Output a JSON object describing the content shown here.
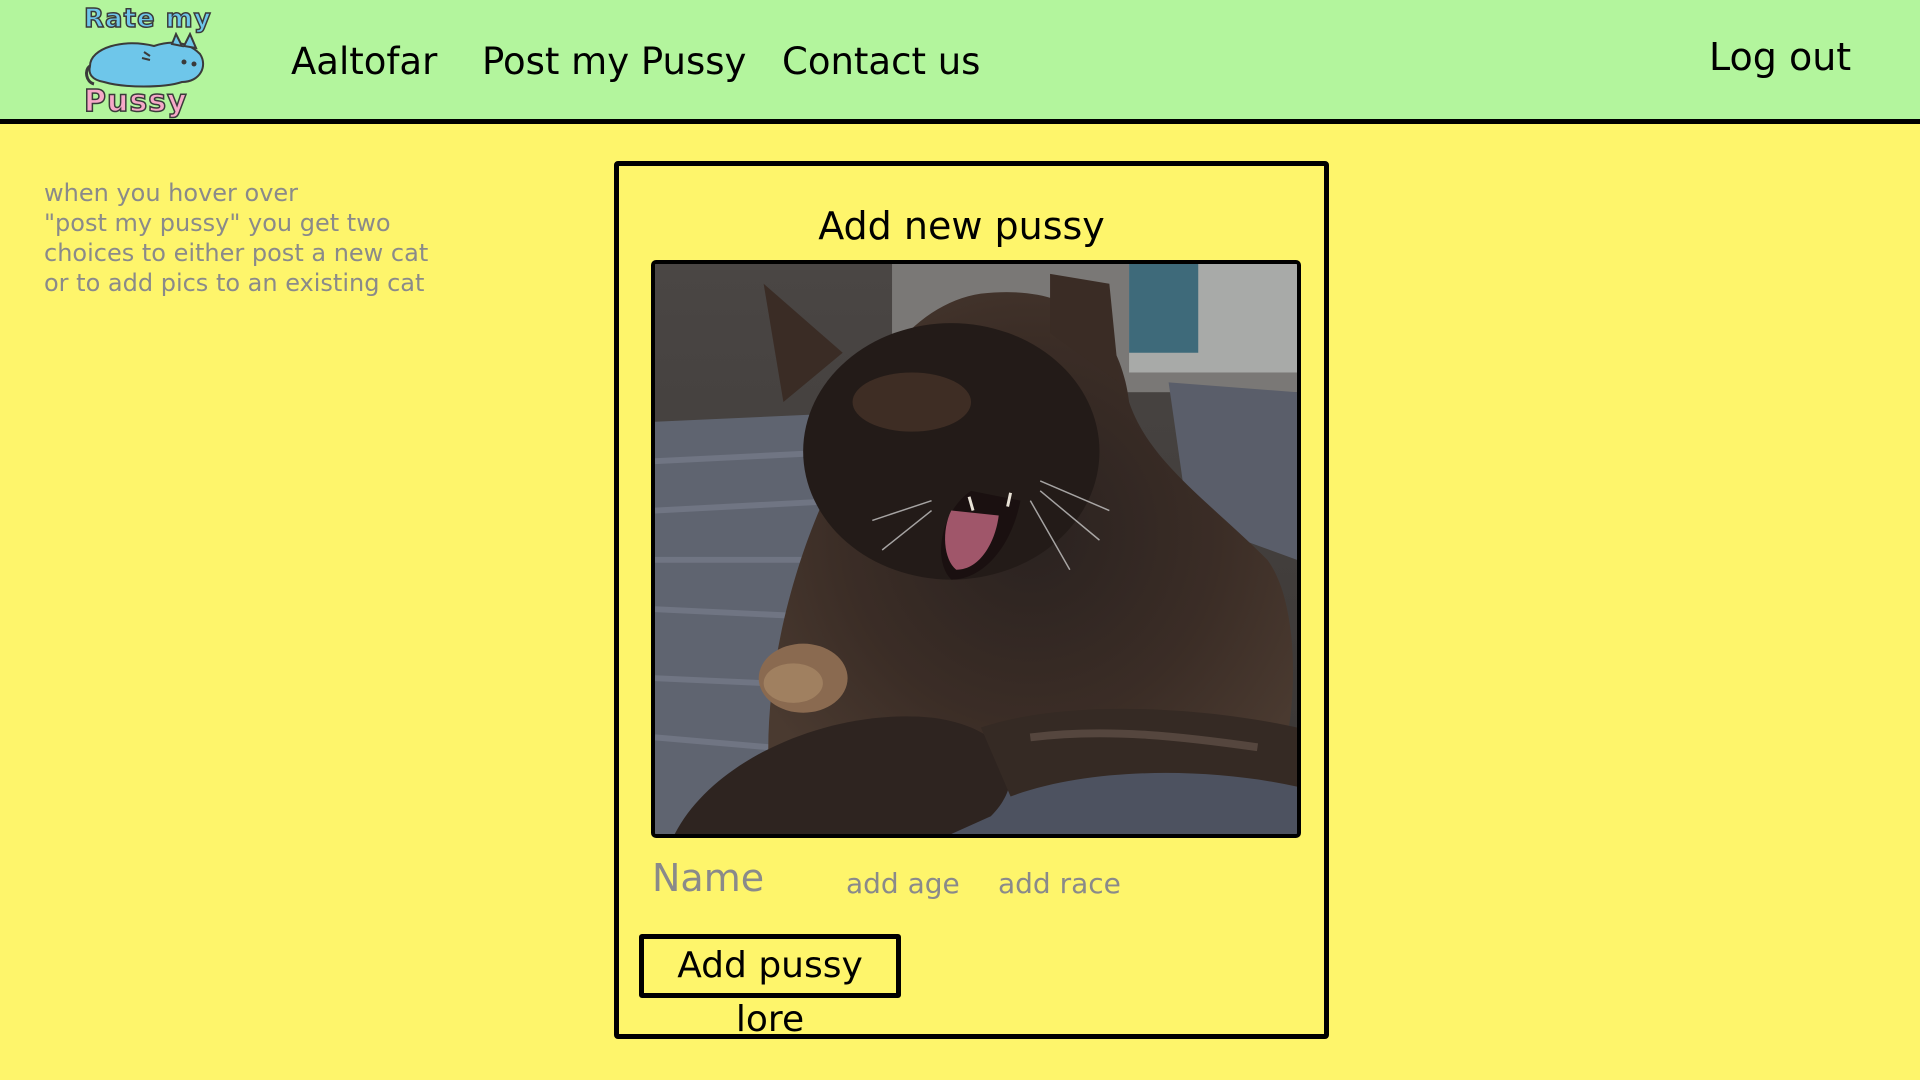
{
  "header": {
    "logo": {
      "top_text": "Rate my",
      "bottom_text": "Pussy"
    },
    "nav": [
      {
        "label": "Aaltofar"
      },
      {
        "label": "Post my Pussy"
      },
      {
        "label": "Contact us"
      }
    ],
    "logout_label": "Log out"
  },
  "hint": {
    "lines": [
      "when you hover over",
      "\"post my pussy\" you get two",
      "choices to either post a new cat",
      "or to add pics to an existing cat"
    ]
  },
  "card": {
    "title": "Add new pussy",
    "fields": {
      "name_placeholder": "Name",
      "age_placeholder": "add age",
      "race_placeholder": "add race"
    },
    "lore_button_label": "Add pussy lore"
  },
  "colors": {
    "header_bg": "#b3f59d",
    "page_bg": "#fef56b",
    "placeholder_text": "#8a8a8a"
  }
}
